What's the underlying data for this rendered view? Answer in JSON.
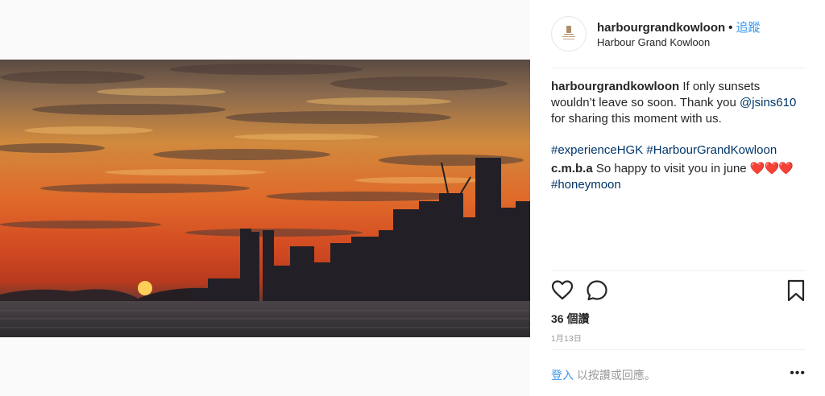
{
  "post": {
    "username": "harbourgrandkowloon",
    "follow_label": "追蹤",
    "location": "Harbour Grand Kowloon",
    "caption": {
      "user": "harbourgrandkowloon",
      "text_1": " If only sunsets wouldn’t leave so soon. Thank you ",
      "mention": "@jsins610",
      "text_2": " for sharing this moment with us.",
      "hashtag_1": "#experienceHGK",
      "hashtag_2": "#HarbourGrandKowloon"
    },
    "comment": {
      "user": "c.m.b.a",
      "text": " So happy to visit you in june ",
      "emoji": "❤️❤️❤️",
      "hashtag": "#honeymoon"
    },
    "likes": "36 個讚",
    "date": "1月13日"
  },
  "footer": {
    "login_label": "登入",
    "login_text": "以按讚或回應。",
    "more_icon": "•••"
  },
  "icons": {
    "like": "heart-outline",
    "comment": "speech-bubble",
    "save": "bookmark-outline",
    "more": "ellipsis"
  },
  "colors": {
    "link_blue": "#3897f0",
    "hashtag_blue": "#003569",
    "muted_gray": "#999999"
  }
}
